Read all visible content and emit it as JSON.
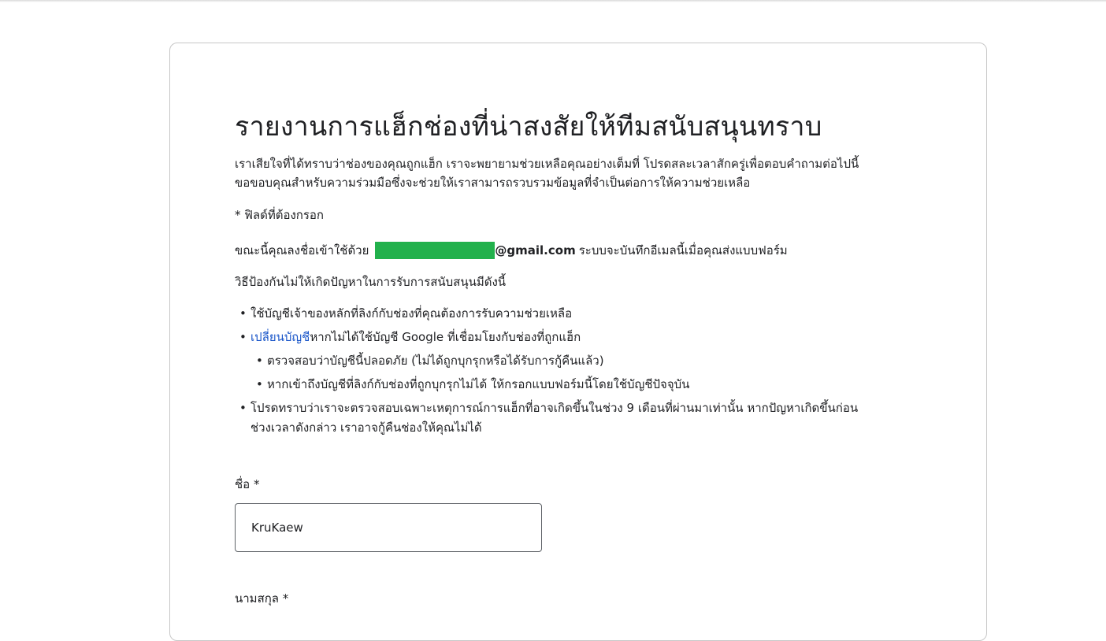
{
  "form": {
    "title": "รายงานการแฮ็กช่องที่น่าสงสัยให้ทีมสนับสนุนทราบ",
    "intro_line1": "เราเสียใจที่ได้ทราบว่าช่องของคุณถูกแฮ็ก เราจะพยายามช่วยเหลือคุณอย่างเต็มที่ โปรดสละเวลาสักครู่เพื่อตอบคำถามต่อไปนี้",
    "intro_line2": "ขอขอบคุณสำหรับความร่วมมือซึ่งจะช่วยให้เราสามารถรวบรวมข้อมูลที่จำเป็นต่อการให้ความช่วยเหลือ",
    "required_note": "* ฟิลด์ที่ต้องกรอก",
    "signin_prefix": "ขณะนี้คุณลงชื่อเข้าใช้ด้วย",
    "email_domain": "@gmail.com",
    "signin_suffix": "ระบบจะบันทึกอีเมลนี้เมื่อคุณส่งแบบฟอร์ม",
    "tips_heading": "วิธีป้องกันไม่ให้เกิดปัญหาในการรับการสนับสนุนมีดังนี้",
    "tips": {
      "item1": "ใช้บัญชีเจ้าของหลักที่ลิงก์กับช่องที่คุณต้องการรับความช่วยเหลือ",
      "item2_link": "เปลี่ยนบัญชี",
      "item2_text": "หากไม่ได้ใช้บัญชี Google ที่เชื่อมโยงกับช่องที่ถูกแฮ็ก",
      "sub1": "ตรวจสอบว่าบัญชีนี้ปลอดภัย (ไม่ได้ถูกบุกรุกหรือได้รับการกู้คืนแล้ว)",
      "sub2": "หากเข้าถึงบัญชีที่ลิงก์กับช่องที่ถูกบุกรุกไม่ได้ ให้กรอกแบบฟอร์มนี้โดยใช้บัญชีปัจจุบัน",
      "item3_line1": "โปรดทราบว่าเราจะตรวจสอบเฉพาะเหตุการณ์การแฮ็กที่อาจเกิดขึ้นในช่วง 9 เดือนที่ผ่านมาเท่านั้น หากปัญหาเกิดขึ้นก่อน",
      "item3_line2": "ช่วงเวลาดังกล่าว เราอาจกู้คืนช่องให้คุณไม่ได้"
    },
    "bullet_glyph": "•",
    "first_name_label": "ชื่อ *",
    "first_name_value": "KruKaew",
    "last_name_label": "นามสกุล *"
  },
  "colors": {
    "redaction": "#22b14c",
    "link": "#1a56c9",
    "border": "#c7c7c7"
  }
}
